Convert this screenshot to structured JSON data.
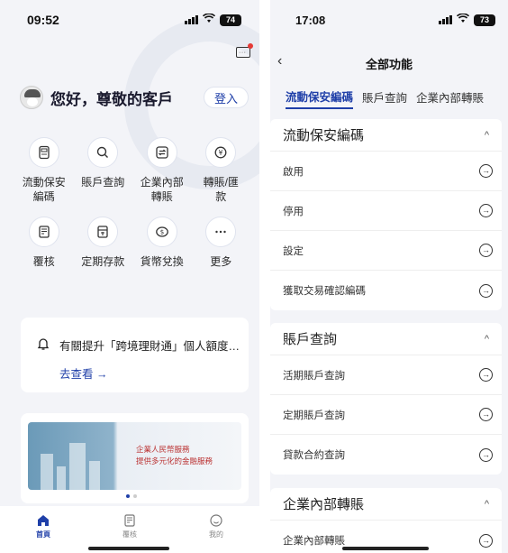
{
  "left": {
    "status": {
      "time": "09:52",
      "battery": "74"
    },
    "greeting": "您好，尊敬的客戶",
    "login_label": "登入",
    "grid": [
      {
        "label": "流動保安編碼",
        "icon": "token-device-icon"
      },
      {
        "label": "賬戶查詢",
        "icon": "search-icon"
      },
      {
        "label": "企業內部轉賬",
        "icon": "transfer-icon"
      },
      {
        "label": "轉賬/匯款",
        "icon": "remittance-icon"
      },
      {
        "label": "覆核",
        "icon": "review-document-icon"
      },
      {
        "label": "定期存款",
        "icon": "time-deposit-icon"
      },
      {
        "label": "貨幣兌換",
        "icon": "currency-exchange-icon"
      },
      {
        "label": "更多",
        "icon": "more-icon"
      }
    ],
    "notice": {
      "text": "有關提升「跨境理財通」個人額度…",
      "link": "去查看 →"
    },
    "banner": {
      "line1": "企業人民幣服務",
      "line2": "提供多元化的金融服務"
    },
    "tabs": [
      {
        "label": "首頁",
        "icon": "home-icon",
        "active": true
      },
      {
        "label": "覆核",
        "icon": "review-icon",
        "active": false
      },
      {
        "label": "我的",
        "icon": "profile-icon",
        "active": false
      }
    ]
  },
  "right": {
    "status": {
      "time": "17:08",
      "battery": "73"
    },
    "title": "全部功能",
    "segments": [
      "流動保安編碼",
      "賬戶查詢",
      "企業內部轉賬"
    ],
    "sections": [
      {
        "title": "流動保安編碼",
        "items": [
          "啟用",
          "停用",
          "設定",
          "獲取交易確認編碼"
        ]
      },
      {
        "title": "賬戶查詢",
        "items": [
          "活期賬戶查詢",
          "定期賬戶查詢",
          "貸款合約查詢"
        ]
      },
      {
        "title": "企業內部轉賬",
        "items": [
          "企業內部轉賬"
        ]
      }
    ]
  },
  "colors": {
    "accent": "#1f3fa8",
    "background": "#f3f4f8",
    "badge": "#e53935"
  }
}
